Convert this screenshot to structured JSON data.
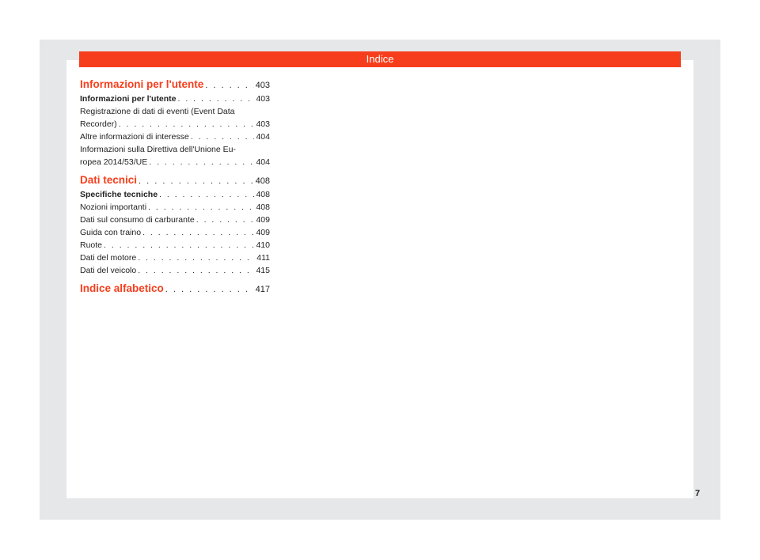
{
  "header": {
    "title": "Indice"
  },
  "toc": {
    "s1": {
      "label": "Informazioni per l'utente",
      "page": "403",
      "i1": {
        "label": "Informazioni per l'utente",
        "page": "403"
      },
      "i2": {
        "line1": "Registrazione di dati di eventi (Event Data",
        "line2": "Recorder)",
        "page": "403"
      },
      "i3": {
        "label": "Altre informazioni di interesse",
        "page": "404"
      },
      "i4": {
        "line1": "Informazioni sulla Direttiva dell'Unione Eu-",
        "line2": "ropea 2014/53/UE",
        "page": "404"
      }
    },
    "s2": {
      "label": "Dati tecnici",
      "page": "408",
      "i1": {
        "label": "Specifiche tecniche",
        "page": "408"
      },
      "i2": {
        "label": "Nozioni importanti",
        "page": "408"
      },
      "i3": {
        "label": "Dati sul consumo di carburante",
        "page": "409"
      },
      "i4": {
        "label": "Guida con traino",
        "page": "409"
      },
      "i5": {
        "label": "Ruote",
        "page": "410"
      },
      "i6": {
        "label": "Dati del motore",
        "page": "411"
      },
      "i7": {
        "label": "Dati del veicolo",
        "page": "415"
      }
    },
    "s3": {
      "label": "Indice alfabetico",
      "page": "417"
    }
  },
  "footer": {
    "page_number": "7"
  },
  "colors": {
    "accent": "#f73e1c",
    "frame": "#e5e7e8"
  }
}
